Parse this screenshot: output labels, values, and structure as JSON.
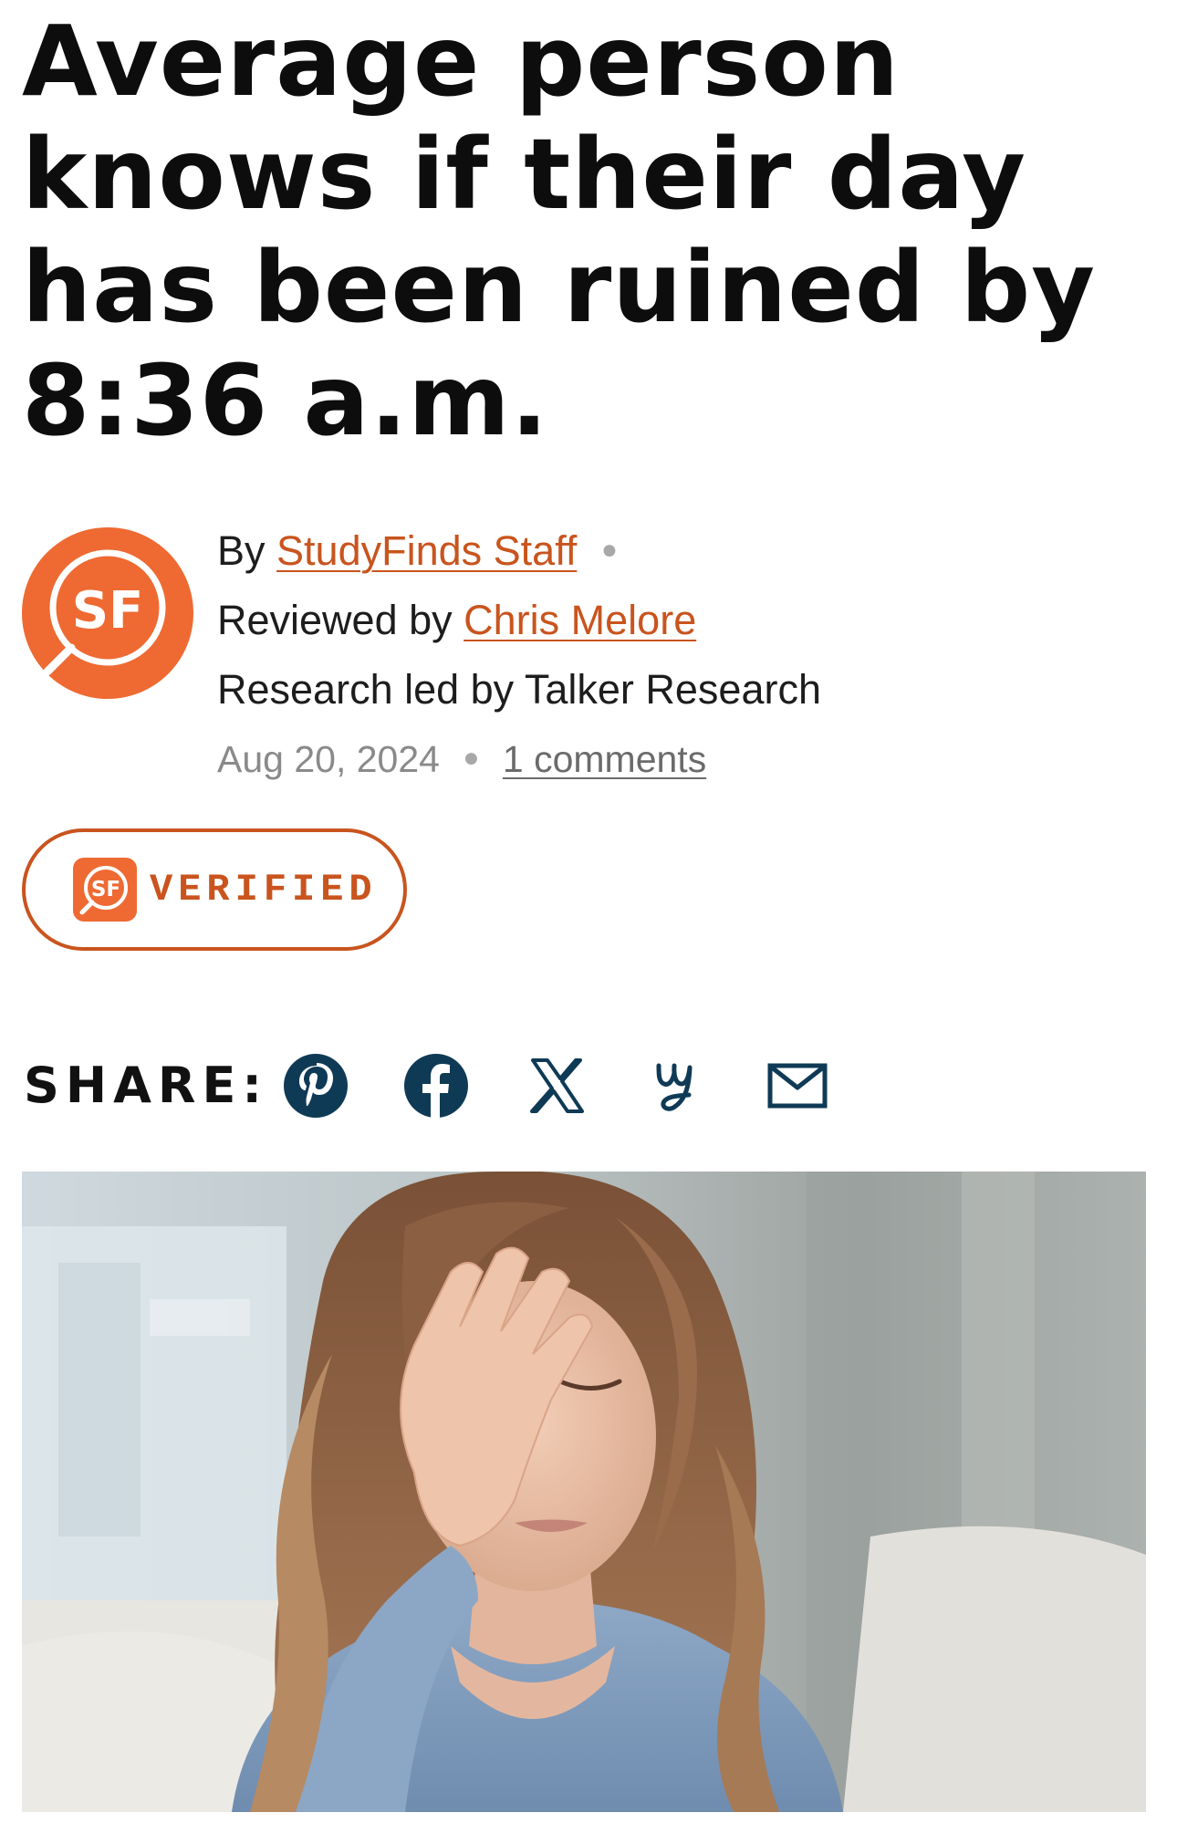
{
  "headline": "Average person knows if their day has been ruined by 8:36 a.m.",
  "byline": {
    "by_prefix": "By",
    "author": "StudyFinds Staff",
    "reviewed_prefix": "Reviewed by",
    "reviewer": "Chris Melore",
    "research_credit": "Research led by Talker Research",
    "date": "Aug 20, 2024",
    "comments": "1 comments",
    "avatar_logo": "SF"
  },
  "badge": {
    "label": "VERIFIED",
    "icon": "sf-logo-icon"
  },
  "share": {
    "label": "SHARE:",
    "icons": [
      "pinterest-icon",
      "facebook-icon",
      "x-icon",
      "yummly-icon",
      "email-icon"
    ]
  },
  "hero_image": {
    "subject": "woman-facepalm-photo"
  },
  "colors": {
    "brand_orange": "#c9541e",
    "share_icon_navy": "#0f3a55",
    "text": "#111111",
    "meta_gray": "#8a8a8a"
  }
}
